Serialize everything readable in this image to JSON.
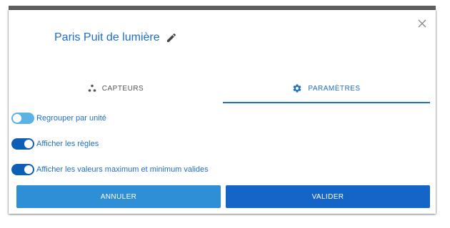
{
  "dialog": {
    "title": "Paris Puit de lumière",
    "close_icon": "close-icon",
    "edit_icon": "pencil-icon"
  },
  "tabs": [
    {
      "label": "CAPTEURS",
      "icon": "sensors-icon",
      "active": false
    },
    {
      "label": "PARAMÈTRES",
      "icon": "gear-icon",
      "active": true
    }
  ],
  "settings": {
    "toggles": [
      {
        "label": "Regrouper par unité",
        "on": false
      },
      {
        "label": "Afficher les règles",
        "on": true
      },
      {
        "label": "Afficher les valeurs maximum et minimum valides",
        "on": true
      }
    ]
  },
  "actions": {
    "cancel_label": "ANNULER",
    "validate_label": "VALIDER"
  },
  "colors": {
    "accent": "#1f6fc5",
    "toggle_on": "#0d5fb5",
    "toggle_off": "#5bb3e5",
    "cancel_bg": "#2e8fd6",
    "validate_bg": "#1565c8"
  }
}
